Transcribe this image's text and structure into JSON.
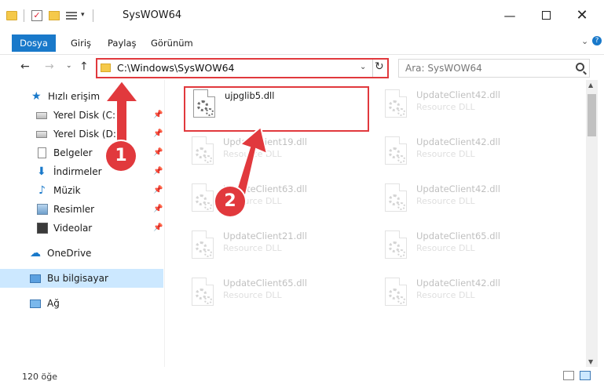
{
  "titlebar": {
    "title": "SysWOW64",
    "check_glyph": "✓",
    "dropdown_glyph": "▾",
    "min": "—",
    "close": "✕"
  },
  "ribbon": {
    "tabs": [
      "Dosya",
      "Giriş",
      "Paylaş",
      "Görünüm"
    ],
    "expand": "⌄",
    "help": "?"
  },
  "nav": {
    "back": "←",
    "forward": "→",
    "recent": "⌄",
    "up": "↑"
  },
  "address": {
    "path": "C:\\Windows\\SysWOW64",
    "dropdown": "⌄",
    "refresh": "↻"
  },
  "search": {
    "placeholder": "Ara: SysWOW64"
  },
  "sidebar": {
    "items": [
      {
        "label": "Hızlı erişim",
        "icon": "star-icon",
        "glyph": "★"
      },
      {
        "label": "Yerel Disk (C:)",
        "icon": "drive-icon",
        "pin": "📌"
      },
      {
        "label": "Yerel Disk (D:)",
        "icon": "drive-icon",
        "pin": "📌"
      },
      {
        "label": "Belgeler",
        "icon": "document-icon",
        "pin": "📌"
      },
      {
        "label": "İndirmeler",
        "icon": "download-icon",
        "glyph": "⬇",
        "pin": "📌"
      },
      {
        "label": "Müzik",
        "icon": "music-icon",
        "glyph": "♪",
        "pin": "📌"
      },
      {
        "label": "Resimler",
        "icon": "pictures-icon",
        "pin": "📌"
      },
      {
        "label": "Videolar",
        "icon": "video-icon",
        "pin": "📌"
      },
      {
        "label": "OneDrive",
        "icon": "cloud-icon",
        "glyph": "☁"
      },
      {
        "label": "Bu bilgisayar",
        "icon": "computer-icon",
        "selected": true
      },
      {
        "label": "Ağ",
        "icon": "network-icon"
      }
    ]
  },
  "files": [
    {
      "name": "ujpglib5.dll",
      "type": ""
    },
    {
      "name": "UpdateClient42.dll",
      "type": "Resource DLL"
    },
    {
      "name": "UpdateClient19.dll",
      "type": "Resource DLL"
    },
    {
      "name": "UpdateClient42.dll",
      "type": "Resource DLL"
    },
    {
      "name": "UpdateClient63.dll",
      "type": "Resource DLL"
    },
    {
      "name": "UpdateClient42.dll",
      "type": "Resource DLL"
    },
    {
      "name": "UpdateClient21.dll",
      "type": "Resource DLL"
    },
    {
      "name": "UpdateClient65.dll",
      "type": "Resource DLL"
    },
    {
      "name": "UpdateClient65.dll",
      "type": "Resource DLL"
    },
    {
      "name": "UpdateClient42.dll",
      "type": "Resource DLL"
    }
  ],
  "status": {
    "count": "120 öğe"
  },
  "annotations": {
    "step1": "1",
    "step2": "2",
    "color": "#e1393d"
  },
  "colors": {
    "accent": "#1979ca",
    "selection": "#cce8ff",
    "highlight": "#e1393d"
  }
}
